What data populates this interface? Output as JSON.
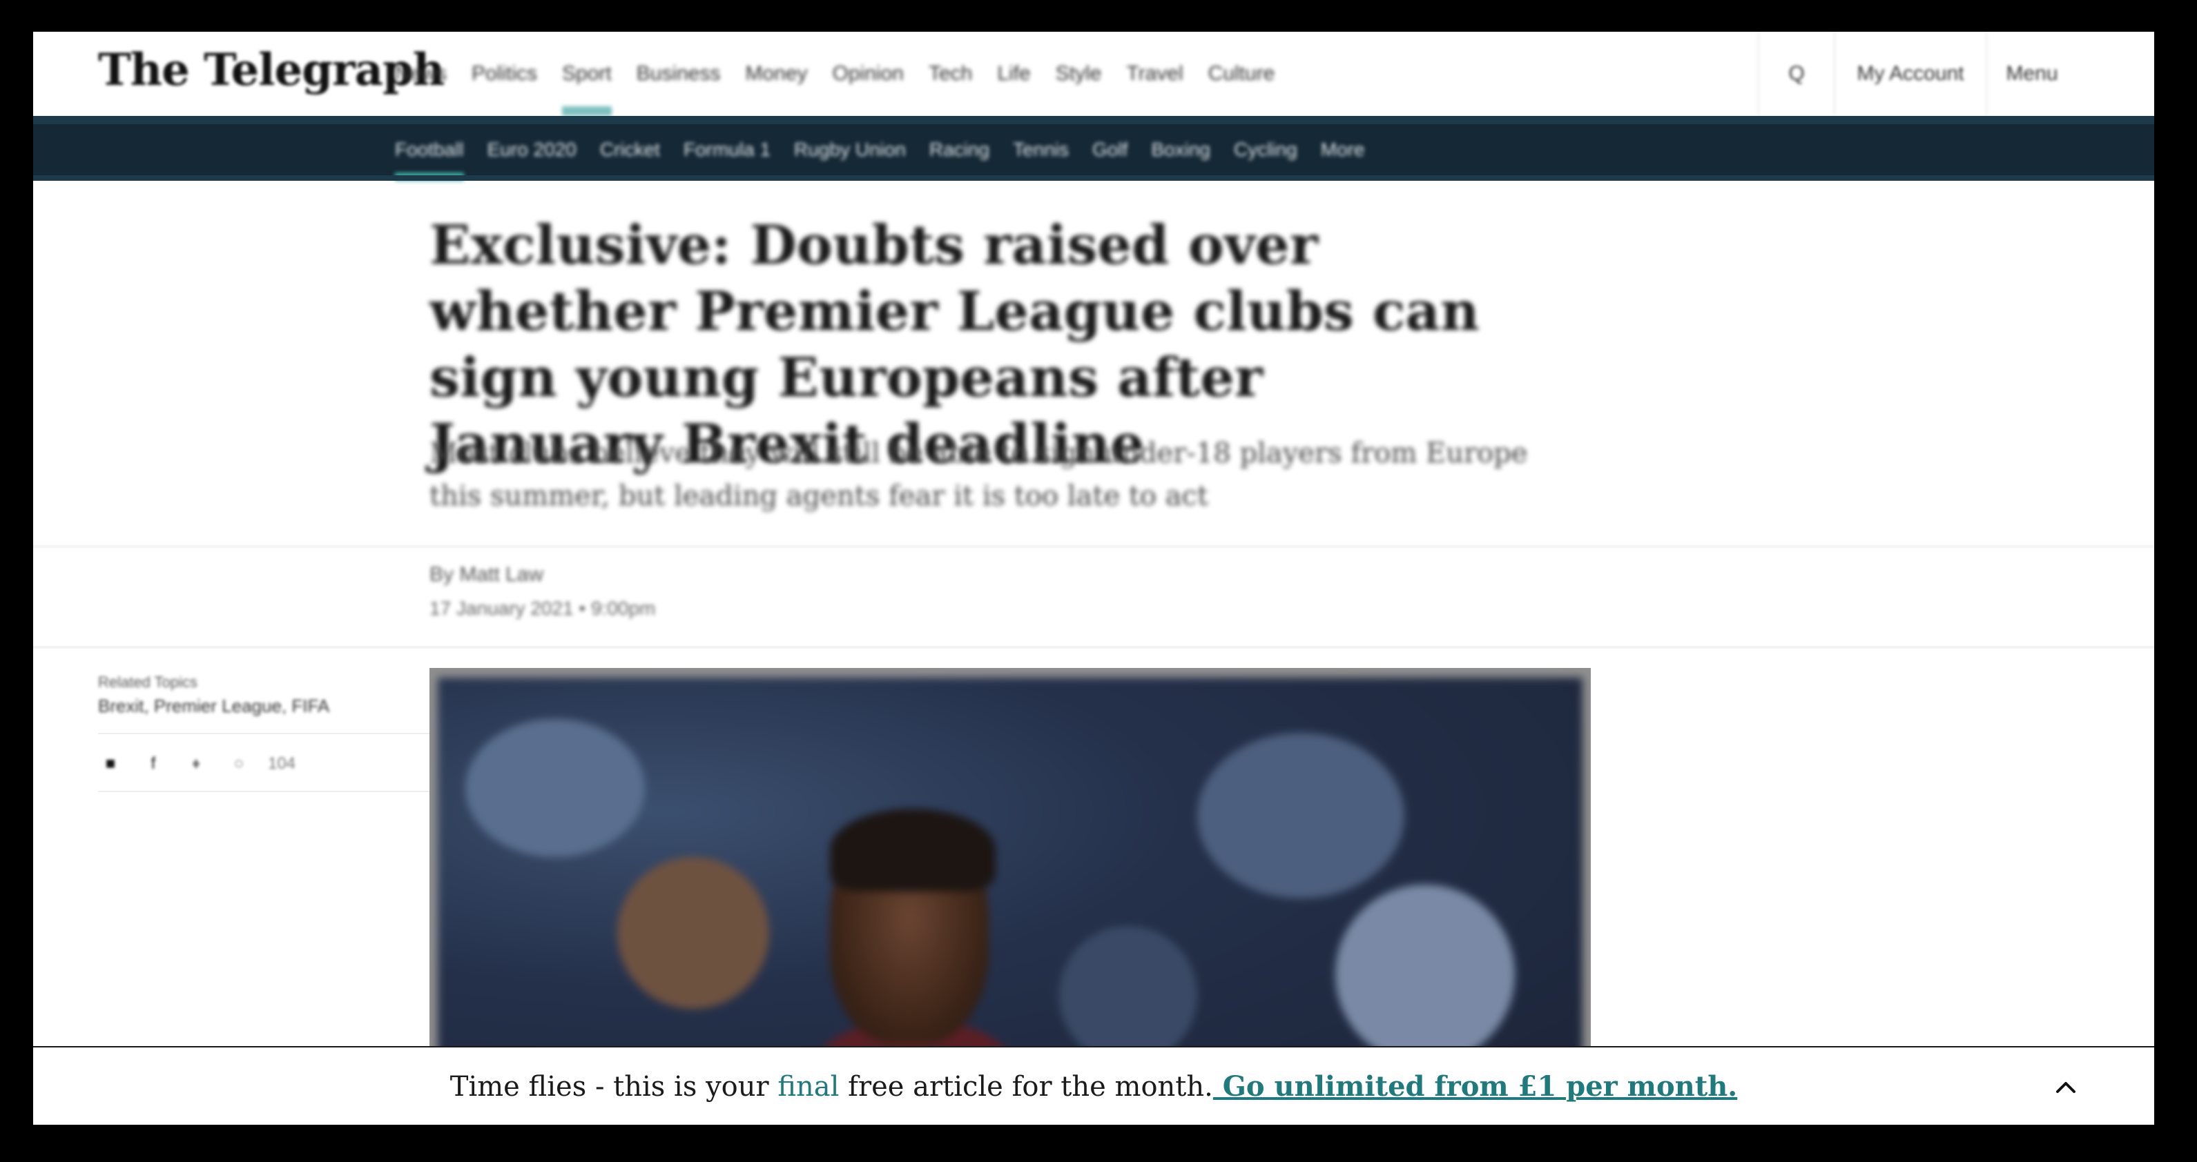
{
  "header": {
    "logo": "The Telegraph",
    "nav": [
      {
        "label": "News",
        "active": false
      },
      {
        "label": "Politics",
        "active": false
      },
      {
        "label": "Sport",
        "active": true
      },
      {
        "label": "Business",
        "active": false
      },
      {
        "label": "Money",
        "active": false
      },
      {
        "label": "Opinion",
        "active": false
      },
      {
        "label": "Tech",
        "active": false
      },
      {
        "label": "Life",
        "active": false
      },
      {
        "label": "Style",
        "active": false
      },
      {
        "label": "Travel",
        "active": false
      },
      {
        "label": "Culture",
        "active": false
      }
    ],
    "search_label": "Q",
    "account_label": "My Account",
    "menu_label": "Menu"
  },
  "section_nav": {
    "items": [
      {
        "label": "Football",
        "active": true
      },
      {
        "label": "Euro 2020",
        "active": false
      },
      {
        "label": "Cricket",
        "active": false
      },
      {
        "label": "Formula 1",
        "active": false
      },
      {
        "label": "Rugby Union",
        "active": false
      },
      {
        "label": "Racing",
        "active": false
      },
      {
        "label": "Tennis",
        "active": false
      },
      {
        "label": "Golf",
        "active": false
      },
      {
        "label": "Boxing",
        "active": false
      },
      {
        "label": "Cycling",
        "active": false
      },
      {
        "label": "More"
      }
    ]
  },
  "article": {
    "headline": "Exclusive: Doubts raised over whether Premier League clubs can sign young Europeans after January Brexit deadline",
    "standfirst": "Most clubs believe they will still be able to sign under-18 players from Europe this summer, but leading agents fear it is too late to act",
    "byline": "By Matt Law",
    "date": "17 January 2021 • 9:00pm",
    "sidebar_label": "Related Topics",
    "sidebar_link": "Brexit, Premier League, FIFA",
    "share_icons": [
      "email-icon",
      "facebook-icon",
      "twitter-icon",
      "whatsapp-icon",
      "comments-icon"
    ],
    "share_count": "104"
  },
  "banner": {
    "prefix": "Time flies - this is your ",
    "highlight": "final",
    "middle": " free article for the month.",
    "cta": " Go unlimited from £1 per month."
  },
  "colors": {
    "brand_teal": "#1e7a7c",
    "section_bar": "#152835",
    "active_underline": "#7fc0c0"
  }
}
